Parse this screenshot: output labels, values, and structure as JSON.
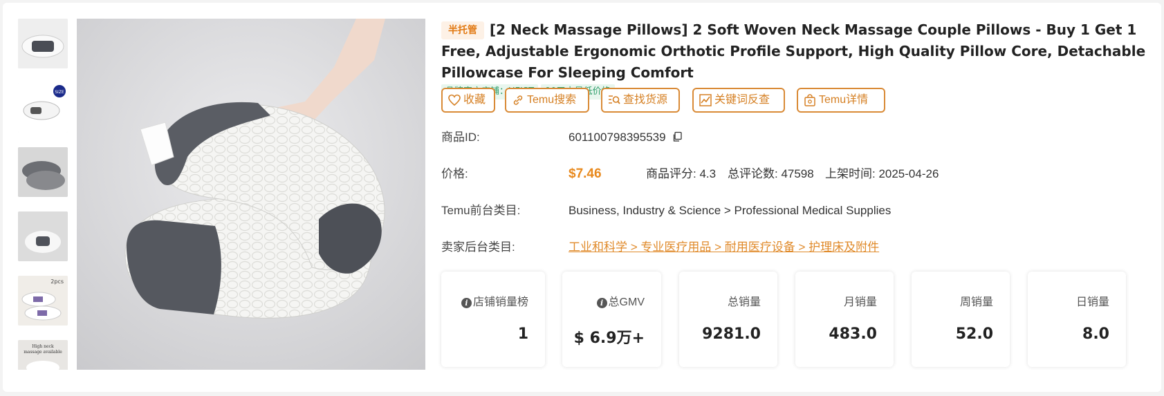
{
  "product": {
    "tag": "半托管",
    "title": "[2 Neck Massage Pillows] 2 Soft Woven Neck Massage Couple Pillows - Buy 1 Get 1 Free, Adjustable Ergonomic Orthotic Profile Support, High Quality Pillow Core, Detachable Pillowcase For Sleeping Comfort",
    "badges": [
      "品牌官方店铺：UFIST",
      "90天内最低价格"
    ]
  },
  "thumbnails": [
    {
      "icon": "pillow-thumbnail-1"
    },
    {
      "icon": "pillow-thumbnail-2",
      "overlay": "SIZE"
    },
    {
      "icon": "pillow-thumbnail-3"
    },
    {
      "icon": "pillow-thumbnail-4"
    },
    {
      "icon": "pillow-thumbnail-5",
      "overlay": "2pcs"
    },
    {
      "icon": "pillow-thumbnail-6",
      "overlay": "High neck\nmassage available"
    }
  ],
  "actions": {
    "favorite": "收藏",
    "temu_search": "Temu搜索",
    "find_source": "查找货源",
    "keyword_reverse": "关键词反查",
    "temu_detail": "Temu详情"
  },
  "details": {
    "id_label": "商品ID:",
    "id_value": "601100798395539",
    "price_label": "价格:",
    "price_value": "$7.46",
    "rating": "商品评分: 4.3",
    "reviews": "总评论数: 47598",
    "listed": "上架时间: 2025-04-26",
    "front_cat_label": "Temu前台类目:",
    "front_cat_value": "Business, Industry & Science > Professional Medical Supplies",
    "back_cat_label": "卖家后台类目:",
    "back_cat_value": "工业和科学 > 专业医疗用品 > 耐用医疗设备 > 护理床及附件"
  },
  "stats": [
    {
      "label": "店铺销量榜",
      "value": "1",
      "info": true
    },
    {
      "label": "总GMV",
      "value": "$ 6.9万+",
      "info": true
    },
    {
      "label": "总销量",
      "value": "9281.0"
    },
    {
      "label": "月销量",
      "value": "483.0"
    },
    {
      "label": "周销量",
      "value": "52.0"
    },
    {
      "label": "日销量",
      "value": "8.0"
    }
  ],
  "colors": {
    "accent": "#d98a36",
    "price": "#e8891d",
    "badge_green": "#2e9d6a",
    "tag_orange": "#e27a14"
  }
}
